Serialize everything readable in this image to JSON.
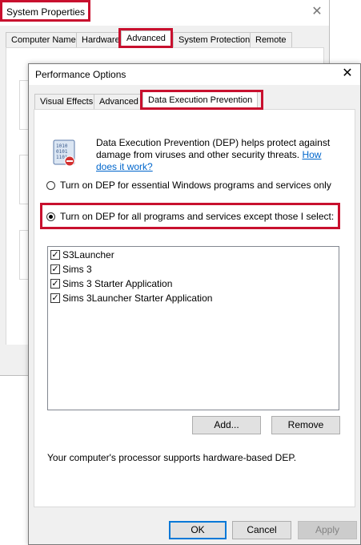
{
  "system_properties": {
    "title": "System Properties",
    "tabs": [
      "Computer Name",
      "Hardware",
      "Advanced",
      "System Protection",
      "Remote"
    ],
    "active_tab": "Advanced"
  },
  "performance_options": {
    "title": "Performance Options",
    "tabs": [
      "Visual Effects",
      "Advanced",
      "Data Execution Prevention"
    ],
    "active_tab": "Data Execution Prevention",
    "description": "Data Execution Prevention (DEP) helps protect against damage from viruses and other security threats.",
    "link_text": "How does it work?",
    "radio_essential_label": "Turn on DEP for essential Windows programs and services only",
    "radio_all_label": "Turn on DEP for all programs and services except those I select:",
    "selected_radio": "all",
    "program_list": [
      {
        "label": "S3Launcher",
        "checked": true
      },
      {
        "label": "Sims 3",
        "checked": true
      },
      {
        "label": "Sims 3 Starter Application",
        "checked": true
      },
      {
        "label": "Sims 3Launcher Starter Application",
        "checked": true
      }
    ],
    "add_button": "Add...",
    "remove_button": "Remove",
    "support_text": "Your computer's processor supports hardware-based DEP.",
    "ok_button": "OK",
    "cancel_button": "Cancel",
    "apply_button": "Apply"
  },
  "icons": {
    "close": "close-icon",
    "dep": "dep-shield-icon",
    "checkmark": "✓"
  },
  "colors": {
    "highlight_outline": "#c8102e",
    "link": "#0066cc",
    "default_button_border": "#0078d7",
    "dialog_background": "#f0f0f0"
  }
}
